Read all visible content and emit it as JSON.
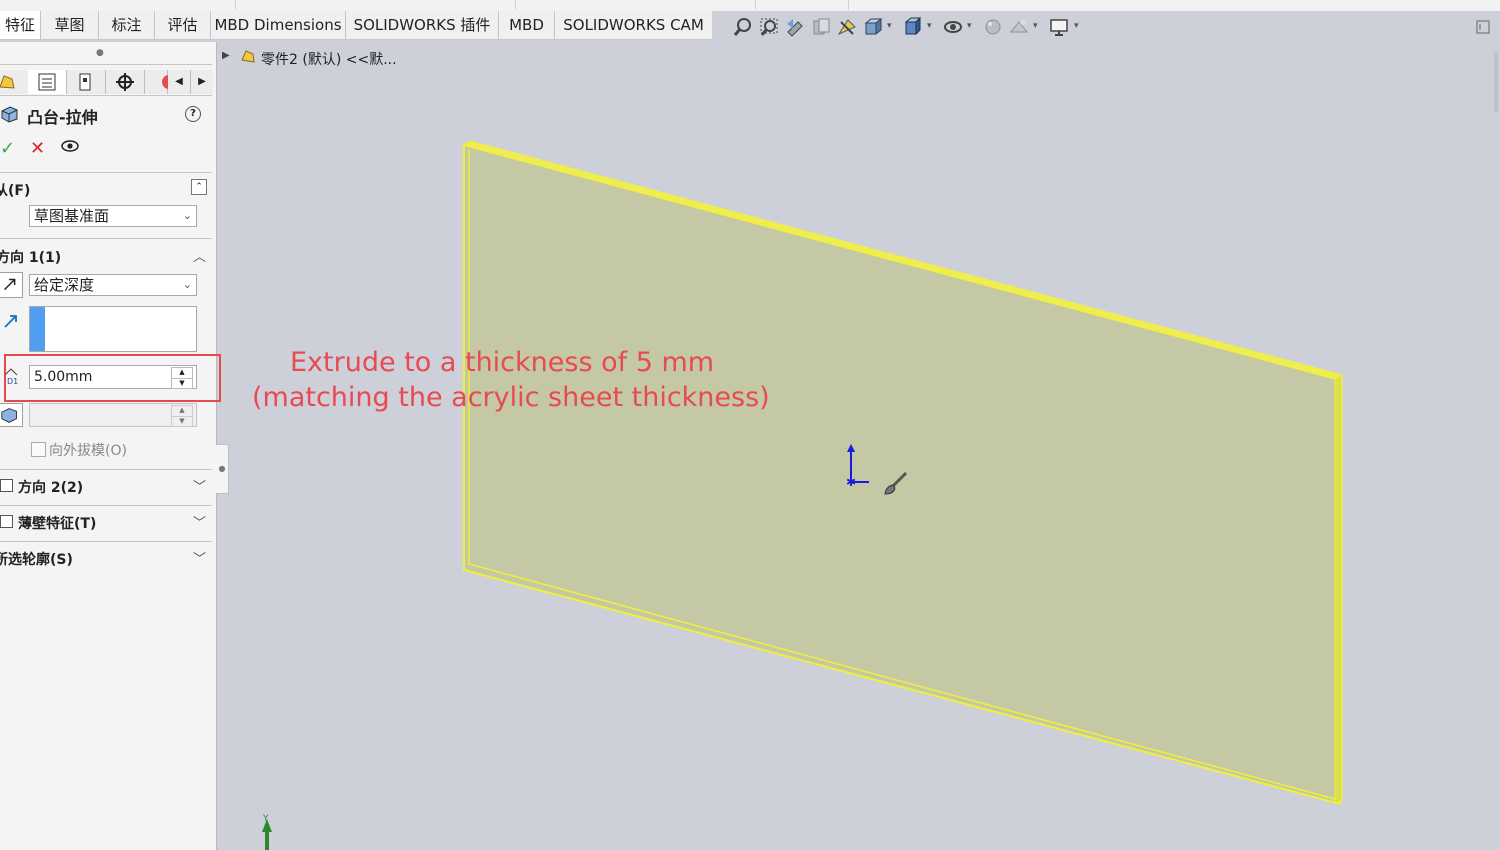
{
  "tabs": [
    {
      "label": "特征",
      "active": true
    },
    {
      "label": "草图",
      "active": false
    },
    {
      "label": "标注",
      "active": false
    },
    {
      "label": "评估",
      "active": false
    },
    {
      "label": "MBD Dimensions",
      "active": false
    },
    {
      "label": "SOLIDWORKS 插件",
      "active": false
    },
    {
      "label": "MBD",
      "active": false
    },
    {
      "label": "SOLIDWORKS CAM",
      "active": false
    }
  ],
  "toolbar_icons": [
    "zoom-to-fit-icon",
    "zoom-area-icon",
    "previous-view-icon",
    "section-view-icon",
    "dynamic-annotation-icon",
    "view-orientation-icon",
    "display-style-icon",
    "hide-show-icon",
    "edit-appearance-icon",
    "apply-scene-icon",
    "view-settings-icon"
  ],
  "feature": {
    "title": "凸台-拉伸",
    "help": "?",
    "from_label": "从(F)",
    "from_value": "草图基准面",
    "dir1_label": "方向 1(1)",
    "end_condition": "给定深度",
    "depth_value": "5.00mm",
    "draft_label": "向外拔模(O)",
    "dir2_label": "方向 2(2)",
    "thin_label": "薄壁特征(T)",
    "contours_label": "所选轮廓(S)"
  },
  "tree": {
    "part_label": "零件2 (默认) <<默..."
  },
  "annotation": {
    "line1": "Extrude to a thickness of 5 mm",
    "line2": "(matching the acrylic sheet thickness)"
  },
  "colors": {
    "annotation": "#e84a52",
    "highlight_box": "#e5484d",
    "part_fill": "#c5c8a4",
    "part_edge": "#f0f03c",
    "viewport_bg": "#cdd0d8"
  }
}
